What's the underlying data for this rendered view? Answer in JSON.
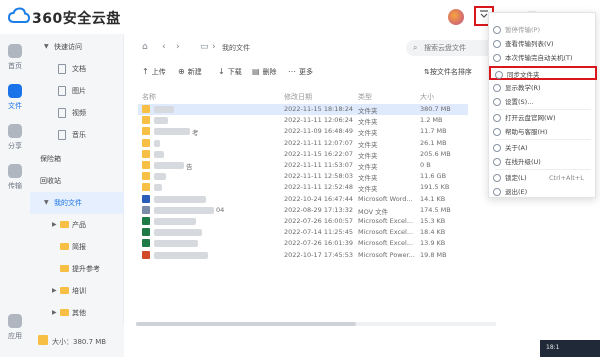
{
  "app": {
    "title": "360安全云盘",
    "window_controls": {
      "menu": "⋯",
      "minimize": "–",
      "maximize": "□",
      "close": "✕"
    }
  },
  "rail": [
    {
      "label": "首页",
      "icon": "home-icon"
    },
    {
      "label": "文件",
      "icon": "file-icon",
      "active": true
    },
    {
      "label": "分享",
      "icon": "share-icon"
    },
    {
      "label": "传输",
      "icon": "transfer-icon"
    },
    {
      "label": "应用",
      "icon": "apps-icon"
    }
  ],
  "sidebar": {
    "quick_access": "快速访问",
    "quick_items": [
      "文档",
      "图片",
      "视频",
      "音乐"
    ],
    "vault": "保险箱",
    "recycle": "回收站",
    "my_files": "我的文件",
    "my_files_items": [
      "产品",
      "简报",
      "提升参考",
      "培训",
      "其他"
    ],
    "footer_size": "大小：380.7 MB"
  },
  "main": {
    "breadcrumb": "我的文件",
    "search_placeholder": "搜索云盘文件",
    "toolbar": {
      "upload": "上传",
      "new": "新建",
      "download": "下载",
      "delete": "删除",
      "more": "更多",
      "sort": "按文件名排序"
    },
    "columns": {
      "name": "名称",
      "modified": "修改日期",
      "type": "类型",
      "size": "大小"
    },
    "rows": [
      {
        "name": "",
        "date": "2022-11-15 18:18:24",
        "type": "文件夹",
        "size": "380.7 MB",
        "icon": "folder",
        "selected": true
      },
      {
        "name": "",
        "date": "2022-11-11 12:06:24",
        "type": "文件夹",
        "size": "1.2 MB",
        "icon": "folder"
      },
      {
        "name": "考",
        "date": "2022-11-09 16:48:49",
        "type": "文件夹",
        "size": "11.7 MB",
        "icon": "folder"
      },
      {
        "name": "",
        "date": "2022-11-11 12:07:07",
        "type": "文件夹",
        "size": "26.1 MB",
        "icon": "folder"
      },
      {
        "name": "",
        "date": "2022-11-15 16:22:07",
        "type": "文件夹",
        "size": "205.6 MB",
        "icon": "folder"
      },
      {
        "name": "告",
        "date": "2022-11-11 11:53:07",
        "type": "文件夹",
        "size": "0 B",
        "icon": "folder"
      },
      {
        "name": "",
        "date": "2022-11-11 12:58:03",
        "type": "文件夹",
        "size": "11.6 GB",
        "icon": "folder"
      },
      {
        "name": "",
        "date": "2022-11-11 12:52:48",
        "type": "文件夹",
        "size": "191.5 KB",
        "icon": "folder"
      },
      {
        "name": "",
        "date": "2022-10-24 16:47:44",
        "type": "Microsoft Word...",
        "size": "14.1 KB",
        "icon": "word"
      },
      {
        "name": "04",
        "date": "2022-08-29 17:13:32",
        "type": "MOV 文件",
        "size": "174.5 MB",
        "icon": "video"
      },
      {
        "name": "",
        "date": "2022-07-26 16:00:57",
        "type": "Microsoft Excel...",
        "size": "15.3 KB",
        "icon": "excel"
      },
      {
        "name": "",
        "date": "2022-07-14 11:25:45",
        "type": "Microsoft Excel...",
        "size": "18.4 KB",
        "icon": "excel"
      },
      {
        "name": "",
        "date": "2022-07-26 16:01:39",
        "type": "Microsoft Excel...",
        "size": "13.9 KB",
        "icon": "excel"
      },
      {
        "name": "",
        "date": "2022-10-17 17:45:53",
        "type": "Microsoft Power...",
        "size": "19.8 MB",
        "icon": "ppt"
      }
    ]
  },
  "menu": {
    "items": [
      {
        "label": "暂停传输(P)",
        "muted": true
      },
      {
        "label": "查看传输列表(V)"
      },
      {
        "label": "本次传输完自动关机(T)"
      },
      {
        "label": "同步文件夹",
        "highlight": true
      },
      {
        "label": "显示教学(R)"
      },
      {
        "label": "设置(S)..."
      },
      {
        "label": "打开云盘官网(W)"
      },
      {
        "label": "帮助与客服(H)"
      },
      {
        "label": "关于(A)"
      },
      {
        "label": "在线升级(U)"
      },
      {
        "label": "锁定(L)",
        "key": "Ctrl+Alt+L"
      },
      {
        "label": "退出(E)"
      }
    ]
  },
  "taskbar": {
    "clock": "18:1"
  }
}
